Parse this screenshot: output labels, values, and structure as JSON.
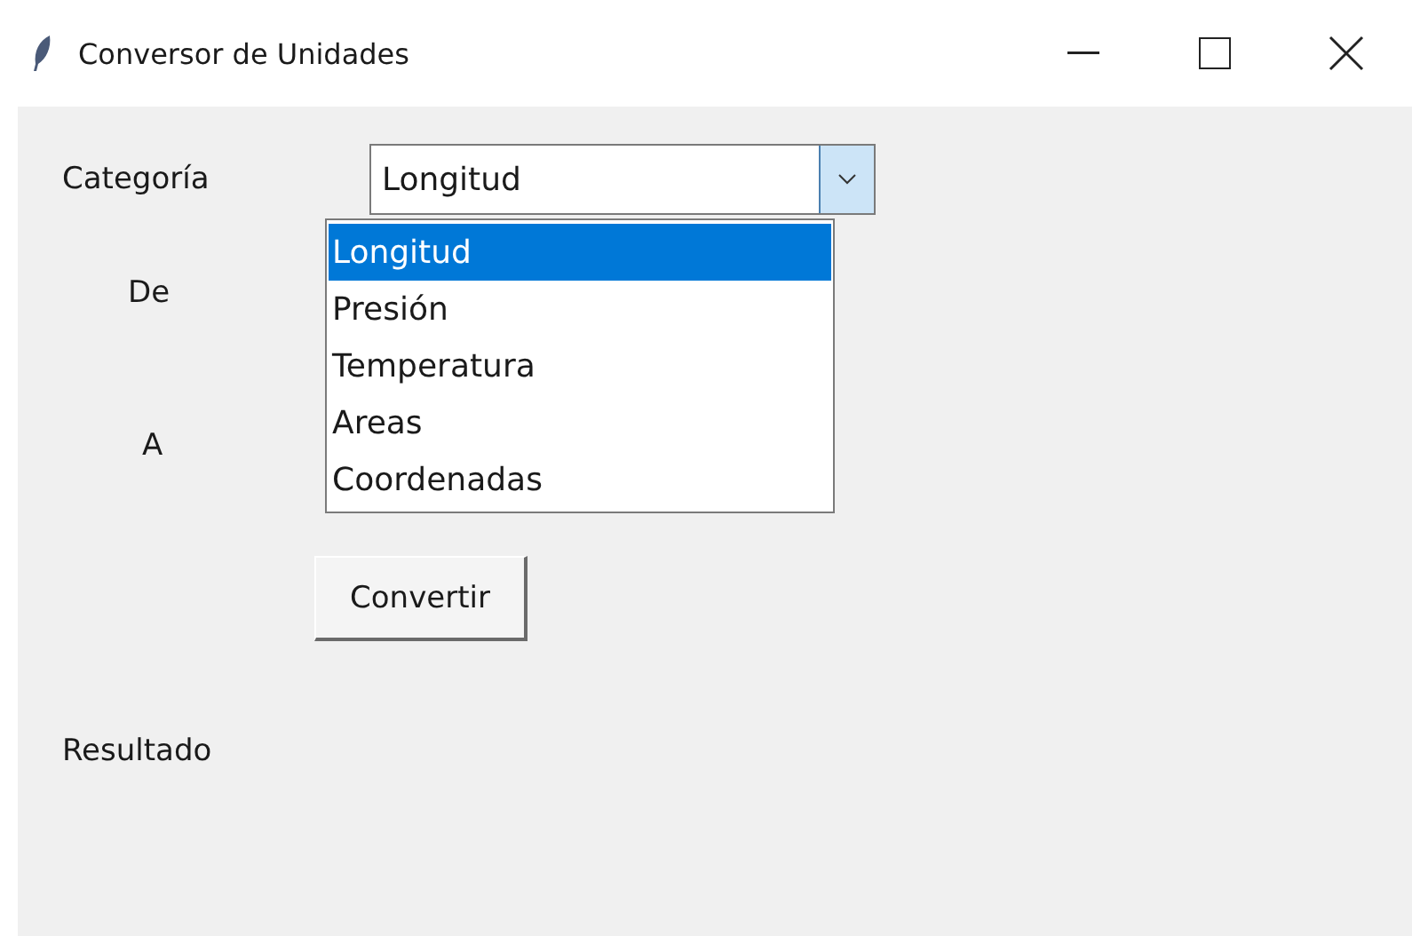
{
  "window": {
    "title": "Conversor de Unidades"
  },
  "category": {
    "label": "Categoría",
    "value": "Longitud",
    "expanded": true,
    "options": [
      {
        "label": "Longitud",
        "selected": true
      },
      {
        "label": "Presión",
        "selected": false
      },
      {
        "label": "Temperatura",
        "selected": false
      },
      {
        "label": "Areas",
        "selected": false
      },
      {
        "label": "Coordenadas",
        "selected": false
      }
    ]
  },
  "from_label": "De",
  "to_label": "A",
  "convert_button": "Convertir",
  "result_label": "Resultado"
}
